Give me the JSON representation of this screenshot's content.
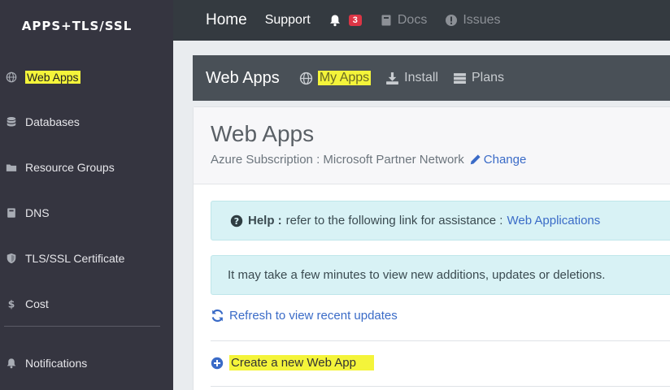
{
  "brand": "APPS+TLS/SSL",
  "sidebar": {
    "items": [
      {
        "label": "Web Apps",
        "icon": "globe-icon"
      },
      {
        "label": "Databases",
        "icon": "database-icon"
      },
      {
        "label": "Resource Groups",
        "icon": "folder-icon"
      },
      {
        "label": "DNS",
        "icon": "book-icon"
      },
      {
        "label": "TLS/SSL Certificate",
        "icon": "shield-icon"
      },
      {
        "label": "Cost",
        "icon": "dollar-icon"
      },
      {
        "label": "Notifications",
        "icon": "bell-icon"
      }
    ]
  },
  "topbar": {
    "home": "Home",
    "support": "Support",
    "notification_count": "3",
    "docs": "Docs",
    "issues": "Issues"
  },
  "subheader": {
    "title": "Web Apps",
    "my_apps": "My Apps",
    "install": "Install",
    "plans": "Plans"
  },
  "card": {
    "title": "Web Apps",
    "subscription": "Azure Subscription : Microsoft Partner Network",
    "change": "Change",
    "help_label": "Help :",
    "help_text": "refer to the following link for assistance :",
    "help_link": "Web Applications",
    "note": "It may take a few minutes to view new additions, updates or deletions.",
    "refresh": "Refresh to view recent updates",
    "create": "Create a new Web App"
  },
  "colors": {
    "sidebar_bg": "#353540",
    "topbar_bg": "#343a40",
    "subheader_bg": "#495057",
    "highlight": "#f4f43a",
    "link": "#3a6bc7",
    "alert_bg": "#d8f2f5",
    "badge": "#dc3545"
  }
}
